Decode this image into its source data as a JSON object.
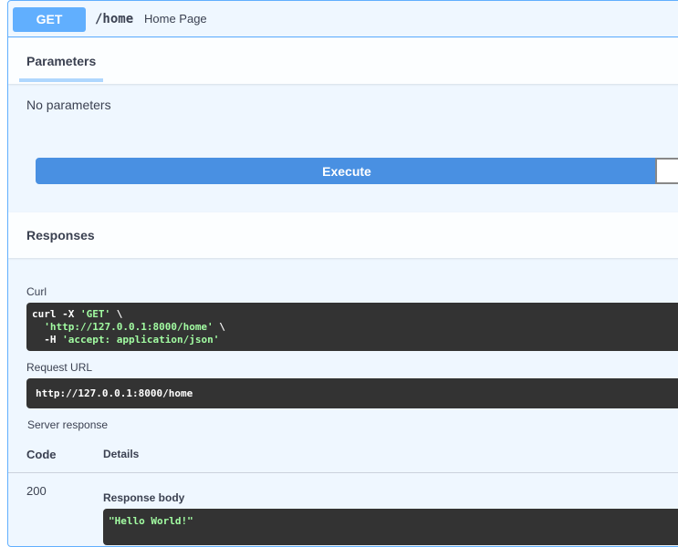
{
  "summary": {
    "method": "GET",
    "path": "/home",
    "description": "Home Page"
  },
  "parameters": {
    "tab_label": "Parameters",
    "empty_text": "No parameters"
  },
  "execute": {
    "label": "Execute"
  },
  "responses": {
    "title": "Responses",
    "curl_label": "Curl",
    "curl_lines": [
      {
        "prefix": "curl -X ",
        "string": "'GET'",
        "suffix": " \\"
      },
      {
        "prefix": "  ",
        "string": "'http://127.0.0.1:8000/home'",
        "suffix": " \\"
      },
      {
        "prefix": "  -H ",
        "string": "'accept: application/json'",
        "suffix": ""
      }
    ],
    "request_url_label": "Request URL",
    "request_url": "http://127.0.0.1:8000/home",
    "server_response_label": "Server response",
    "col_code": "Code",
    "col_details": "Details",
    "status_code": "200",
    "response_body_label": "Response body",
    "response_body": "\"Hello World!\""
  },
  "colors": {
    "get_accent": "#61affe",
    "execute_blue": "#4990e2",
    "code_bg": "#333333",
    "string_green": "#a2fca2"
  }
}
